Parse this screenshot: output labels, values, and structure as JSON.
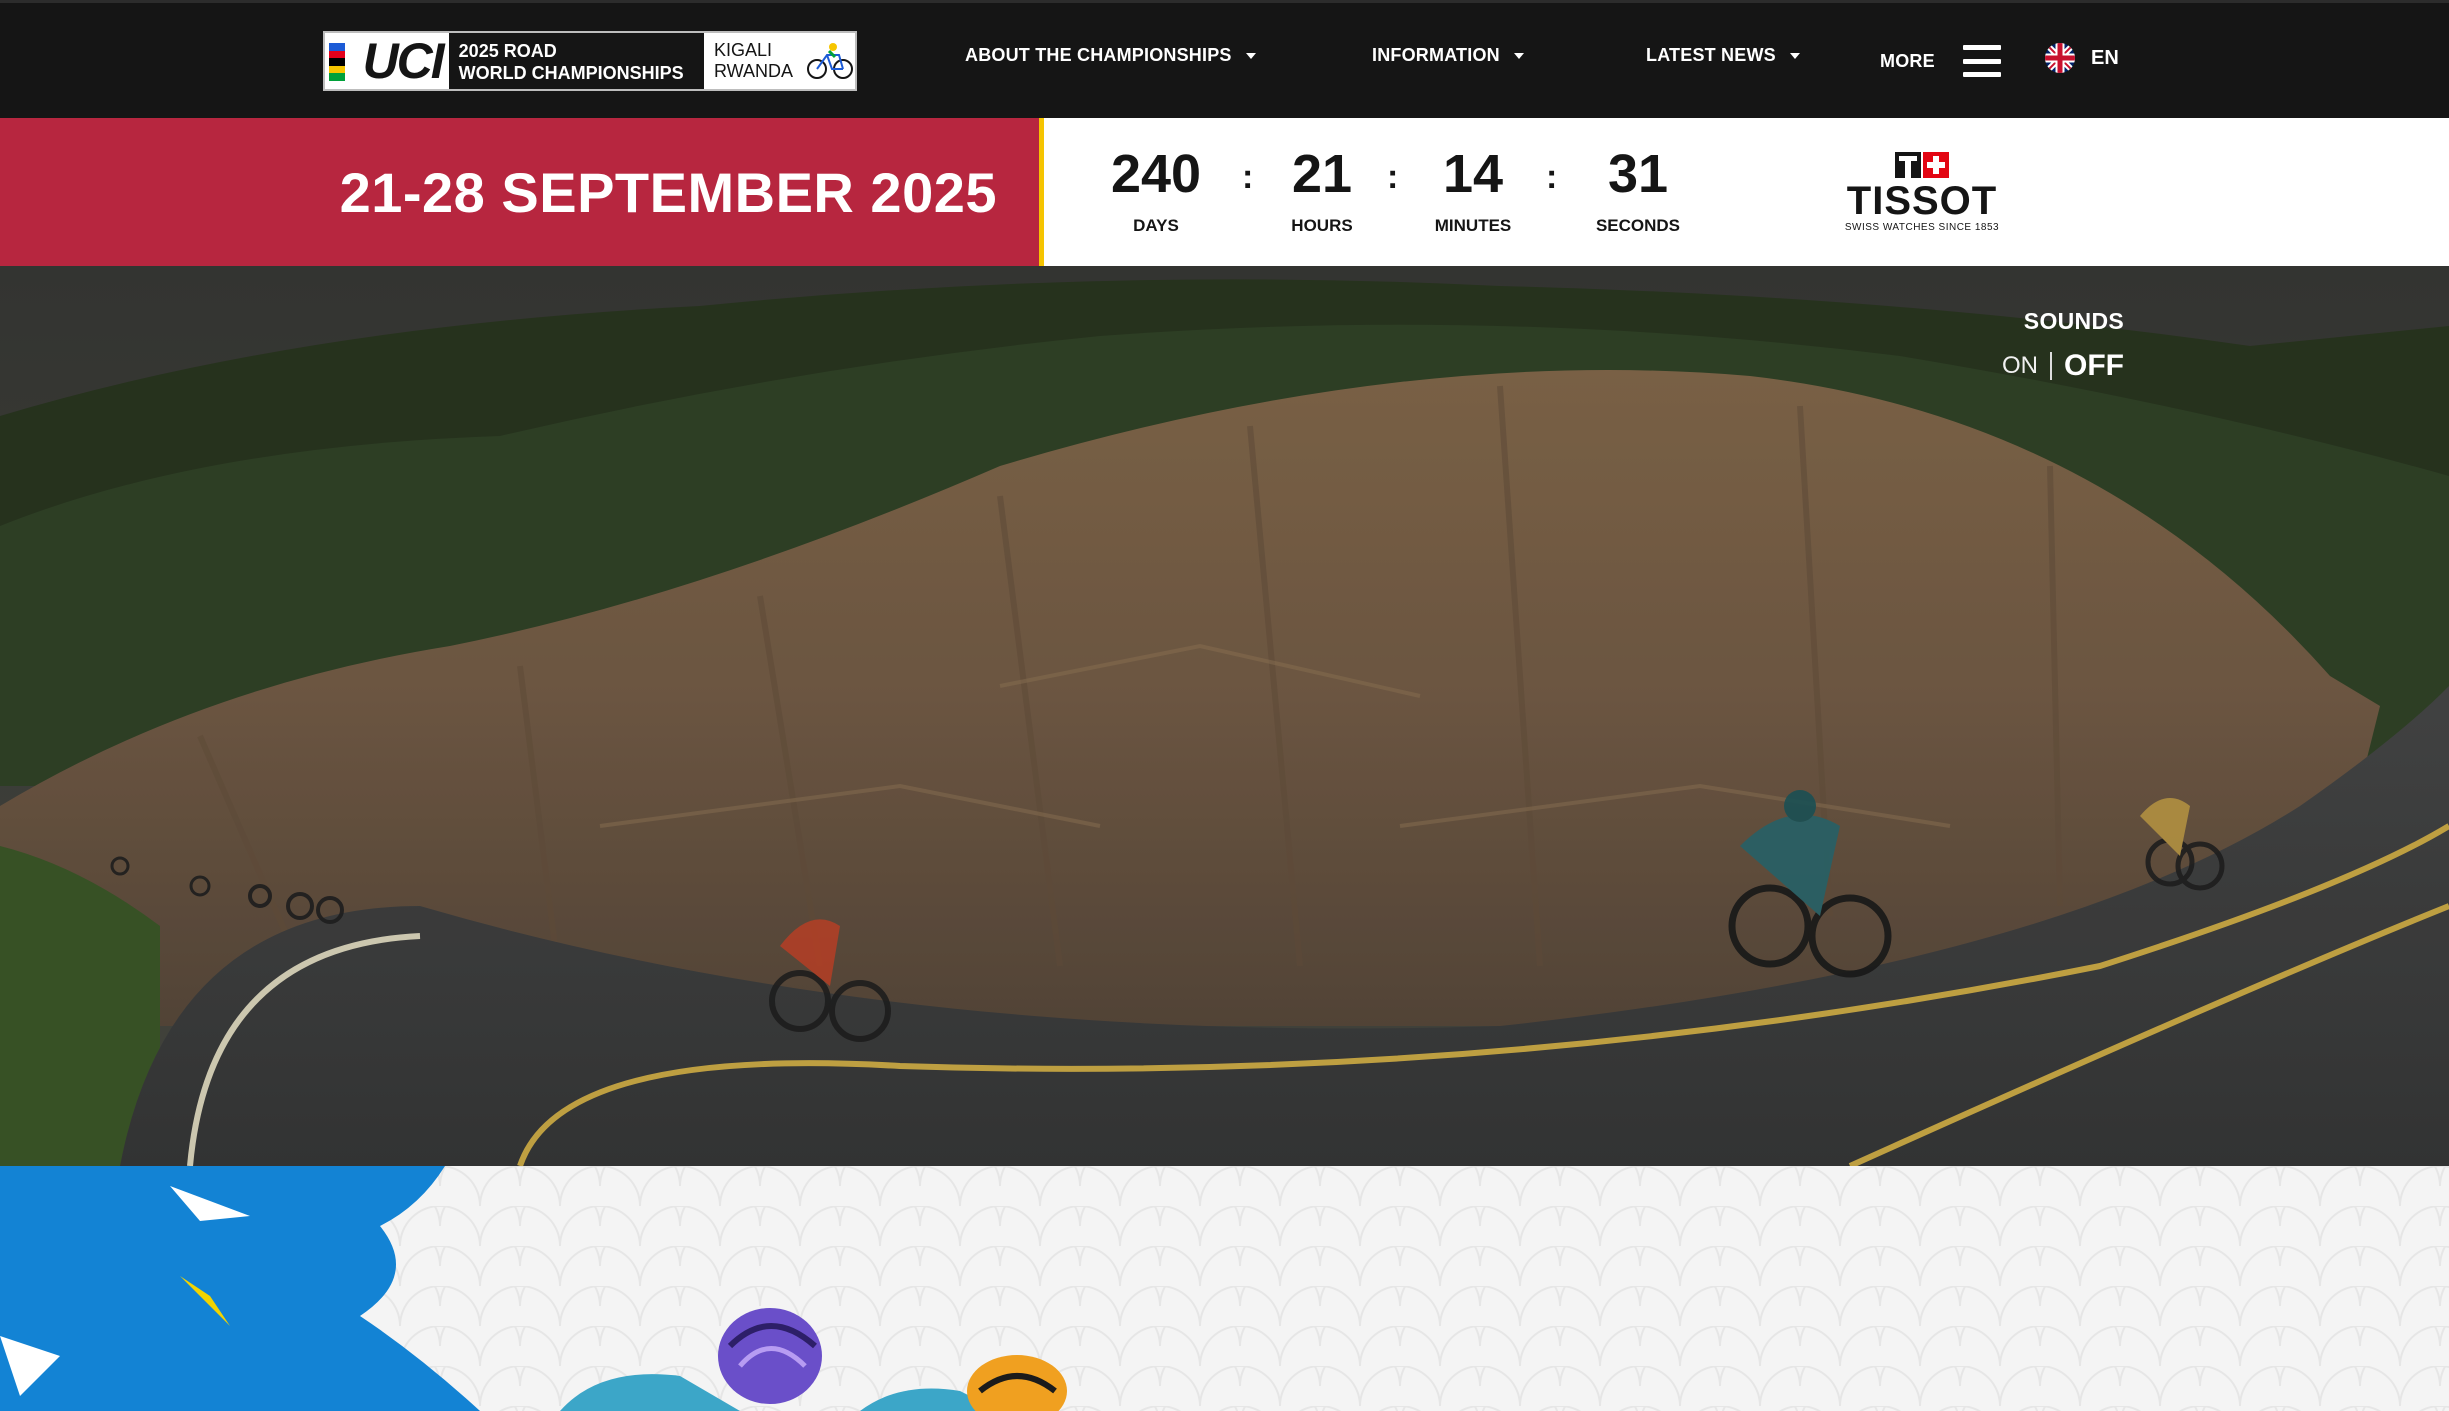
{
  "header": {
    "logo": {
      "brand": "UCI",
      "title_line1": "2025 ROAD",
      "title_line2": "WORLD CHAMPIONSHIPS",
      "host_line1": "KIGALI",
      "host_line2": "RWANDA",
      "rainbow_colors": [
        "#1c5bd6",
        "#e3001b",
        "#000000",
        "#f6c500",
        "#00a13a"
      ]
    },
    "nav": [
      {
        "label": "ABOUT THE CHAMPIONSHIPS",
        "icon": "chevron-down-icon"
      },
      {
        "label": "INFORMATION",
        "icon": "chevron-down-icon"
      },
      {
        "label": "LATEST NEWS",
        "icon": "chevron-down-icon"
      }
    ],
    "more_label": "MORE",
    "more_icon": "hamburger-menu-icon",
    "language": {
      "code": "EN",
      "icon": "uk-flag-icon"
    }
  },
  "event": {
    "dates": "21-28 SEPTEMBER 2025",
    "accent_color": "#b7263f",
    "stripe_color": "#f5c400"
  },
  "countdown": {
    "days": {
      "value": "240",
      "label": "DAYS"
    },
    "hours": {
      "value": "21",
      "label": "HOURS"
    },
    "minutes": {
      "value": "14",
      "label": "MINUTES"
    },
    "seconds": {
      "value": "31",
      "label": "SECONDS"
    },
    "separator": ":"
  },
  "sponsor": {
    "name": "TISSOT",
    "tagline": "SWISS WATCHES SINCE 1853"
  },
  "hero": {
    "sounds_title": "SOUNDS",
    "sounds_on": "ON",
    "sounds_off": "OFF"
  }
}
